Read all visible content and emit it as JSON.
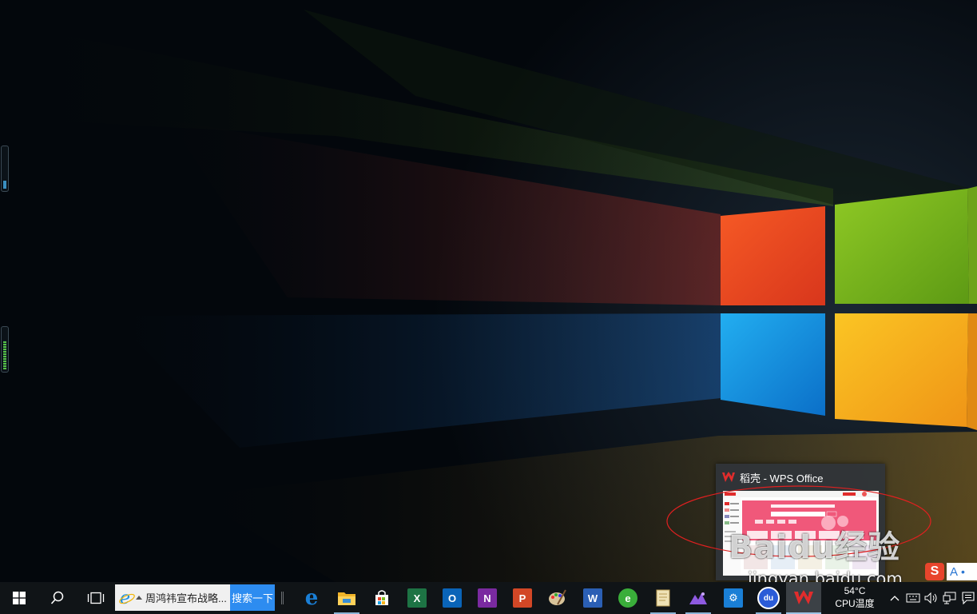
{
  "preview": {
    "title": "稻壳 - WPS Office",
    "thumb_banner": "稻壳会员",
    "thumb_app_name": "稻壳"
  },
  "watermark": {
    "brand": "Bai",
    "brand2": "du",
    "brand3": "经验",
    "url": "jingyan.baidu.com"
  },
  "taskbar": {
    "search_text": "周鸿祎宣布战略...",
    "search_button": "搜索一下",
    "apps": [
      {
        "name": "edge-icon",
        "glyph": "e",
        "color": "#1a7fd6",
        "running": false
      },
      {
        "name": "file-explorer-icon",
        "glyph": "",
        "color": "#f0b429",
        "running": true
      },
      {
        "name": "store-icon",
        "glyph": "",
        "color": "#ffffff",
        "running": false
      },
      {
        "name": "excel-icon",
        "glyph": "X",
        "color": "#1d7344",
        "running": false
      },
      {
        "name": "outlook-icon",
        "glyph": "O",
        "color": "#0a64b8",
        "running": false
      },
      {
        "name": "onenote-icon",
        "glyph": "N",
        "color": "#7a2aa0",
        "running": false
      },
      {
        "name": "powerpoint-icon",
        "glyph": "P",
        "color": "#d24726",
        "running": false
      },
      {
        "name": "paint-icon",
        "glyph": "",
        "color": "#c8b48a",
        "running": false
      },
      {
        "name": "word-icon",
        "glyph": "W",
        "color": "#2b5fb4",
        "running": false
      },
      {
        "name": "360-browser-icon",
        "glyph": "e",
        "color": "#3aae3a",
        "running": false
      },
      {
        "name": "notepad-scroll-icon",
        "glyph": "",
        "color": "#e8d9a8",
        "running": true
      },
      {
        "name": "photos-icon",
        "glyph": "",
        "color": "#7e4fd6",
        "running": true
      },
      {
        "name": "settings-icon",
        "glyph": "⚙",
        "color": "#1a7fd6",
        "running": false
      },
      {
        "name": "baidu-netdisk-icon",
        "glyph": "du",
        "color": "#2a5bd7",
        "running": true
      },
      {
        "name": "wps-icon",
        "glyph": "W",
        "color": "#e12c2c",
        "running": true,
        "active": true
      }
    ],
    "cpu_temp": "54°C",
    "cpu_label": "CPU温度",
    "sogou_letter": "S",
    "sogou_mode": "A",
    "sogou_dot": "•"
  },
  "colors": {
    "win_red": "#f04a20",
    "win_green": "#86bf1c",
    "win_blue": "#1aa3e6",
    "win_yellow": "#f7b51c",
    "annotation": "#e02020"
  }
}
